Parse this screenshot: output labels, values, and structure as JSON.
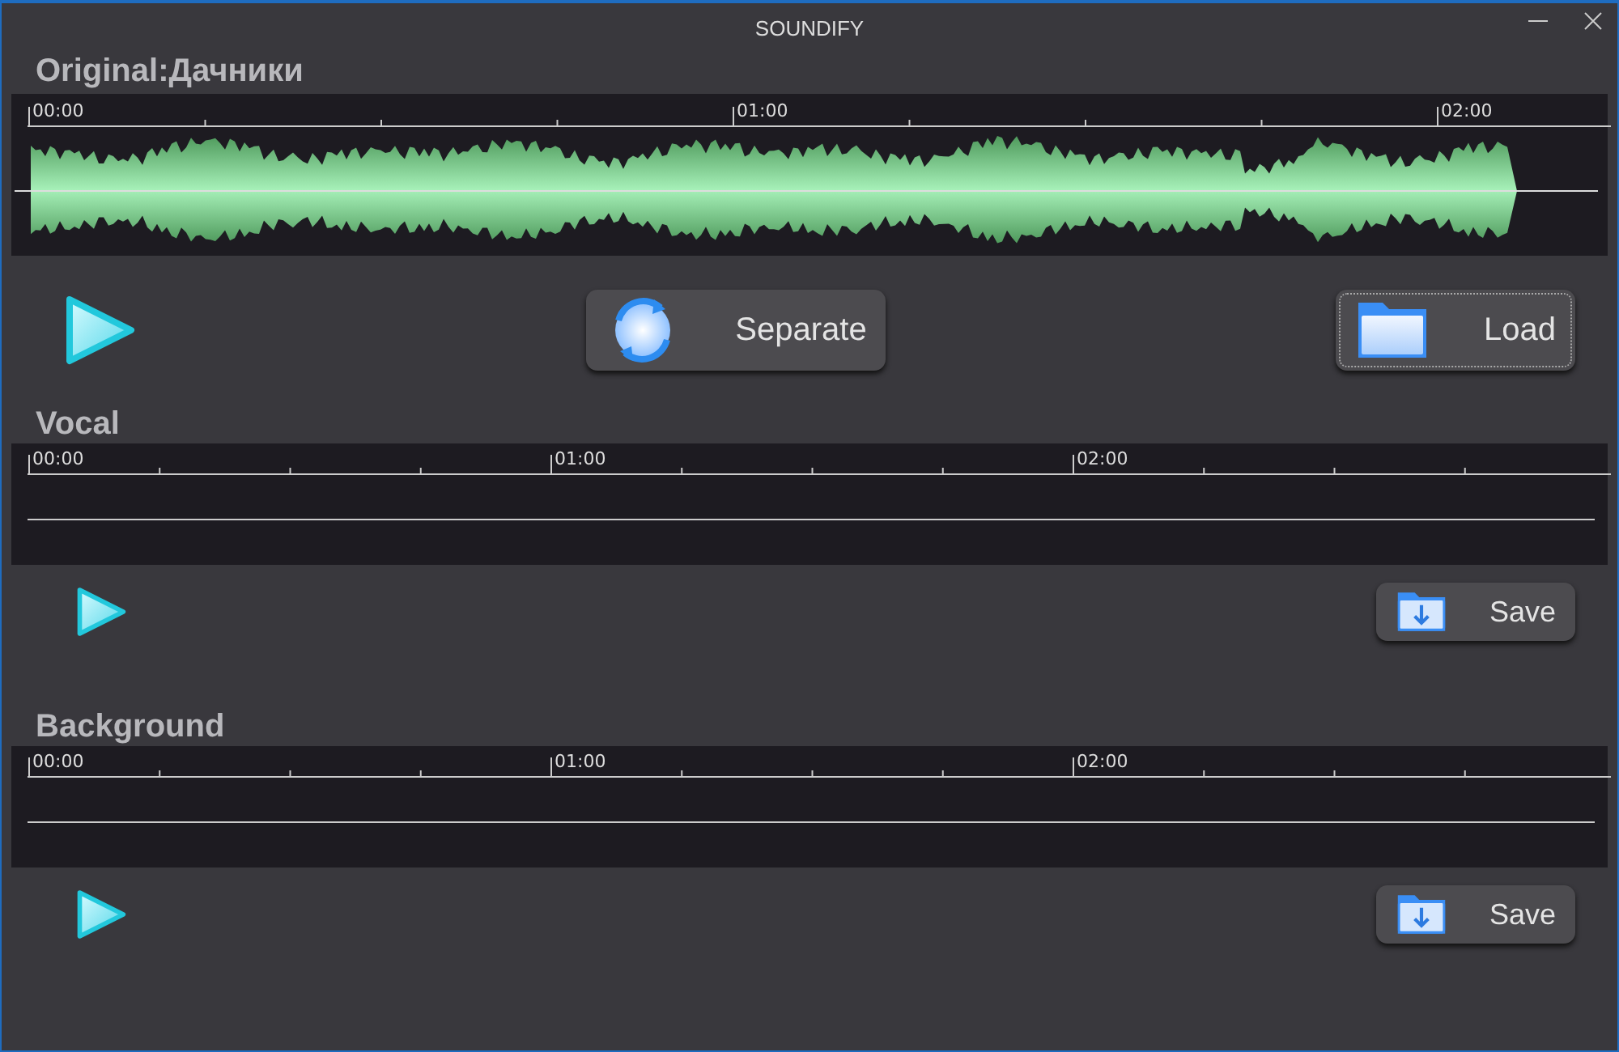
{
  "window": {
    "title": "SOUNDIFY"
  },
  "sections": [
    {
      "title": "Original:Дачники",
      "kind": "waveform",
      "ruler": [
        "00:00",
        "01:00",
        "02:00"
      ],
      "buttons": [
        {
          "kind": "separate",
          "label": "Separate",
          "focused": false
        },
        {
          "kind": "load",
          "label": "Load",
          "focused": true
        }
      ]
    },
    {
      "title": "Vocal",
      "kind": "flat",
      "ruler": [
        "00:00",
        "01:00",
        "02:00"
      ],
      "buttons": [
        {
          "kind": "save",
          "label": "Save",
          "focused": false
        }
      ]
    },
    {
      "title": "Background",
      "kind": "flat",
      "ruler": [
        "00:00",
        "01:00",
        "02:00"
      ],
      "buttons": [
        {
          "kind": "save",
          "label": "Save",
          "focused": false
        }
      ]
    }
  ]
}
